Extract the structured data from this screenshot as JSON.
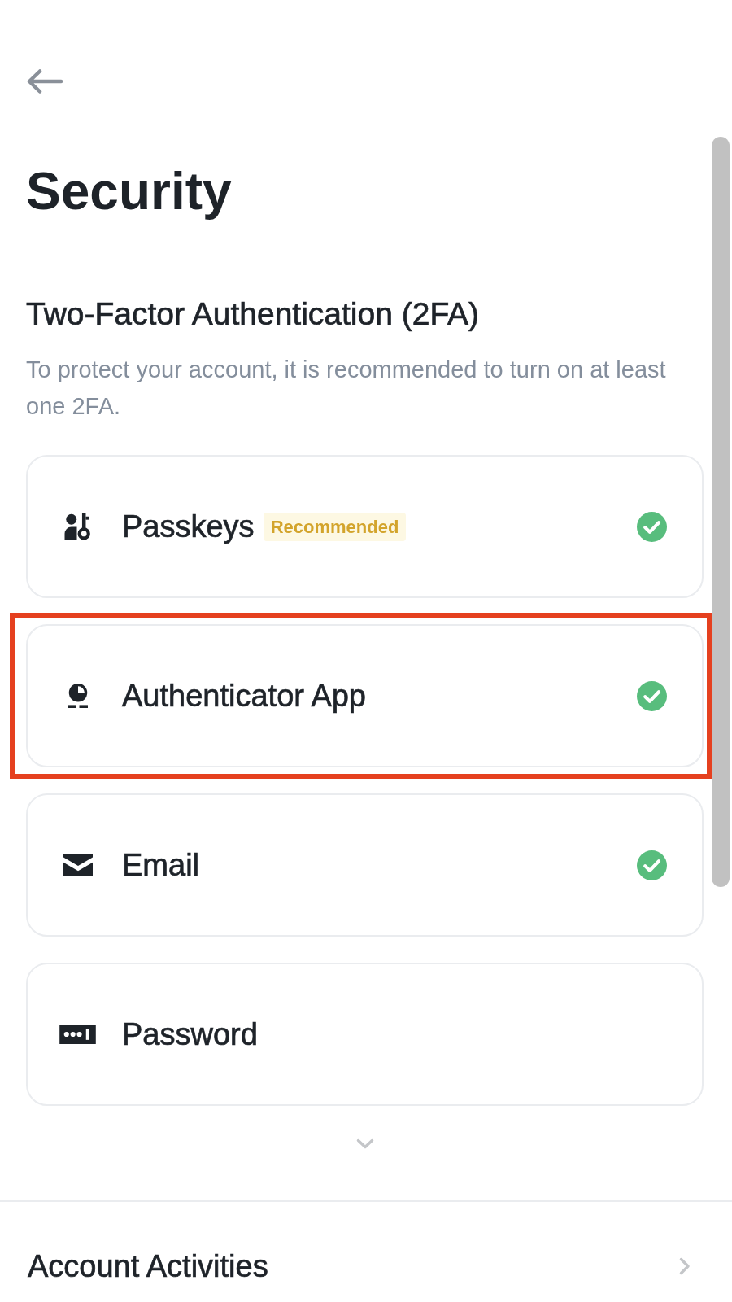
{
  "title": "Security",
  "section": {
    "heading": "Two-Factor Authentication (2FA)",
    "description": "To protect your account, it is recommended to turn on at least one 2FA.",
    "methods": [
      {
        "kind": "passkey",
        "label": "Passkeys",
        "badge": "Recommended",
        "enabled": true,
        "highlighted": false
      },
      {
        "kind": "authenticator",
        "label": "Authenticator App",
        "enabled": true,
        "highlighted": true
      },
      {
        "kind": "email",
        "label": "Email",
        "enabled": true,
        "highlighted": false
      },
      {
        "kind": "password",
        "label": "Password",
        "enabled": false,
        "highlighted": false
      }
    ]
  },
  "links": [
    {
      "label": "Account Activities"
    }
  ]
}
